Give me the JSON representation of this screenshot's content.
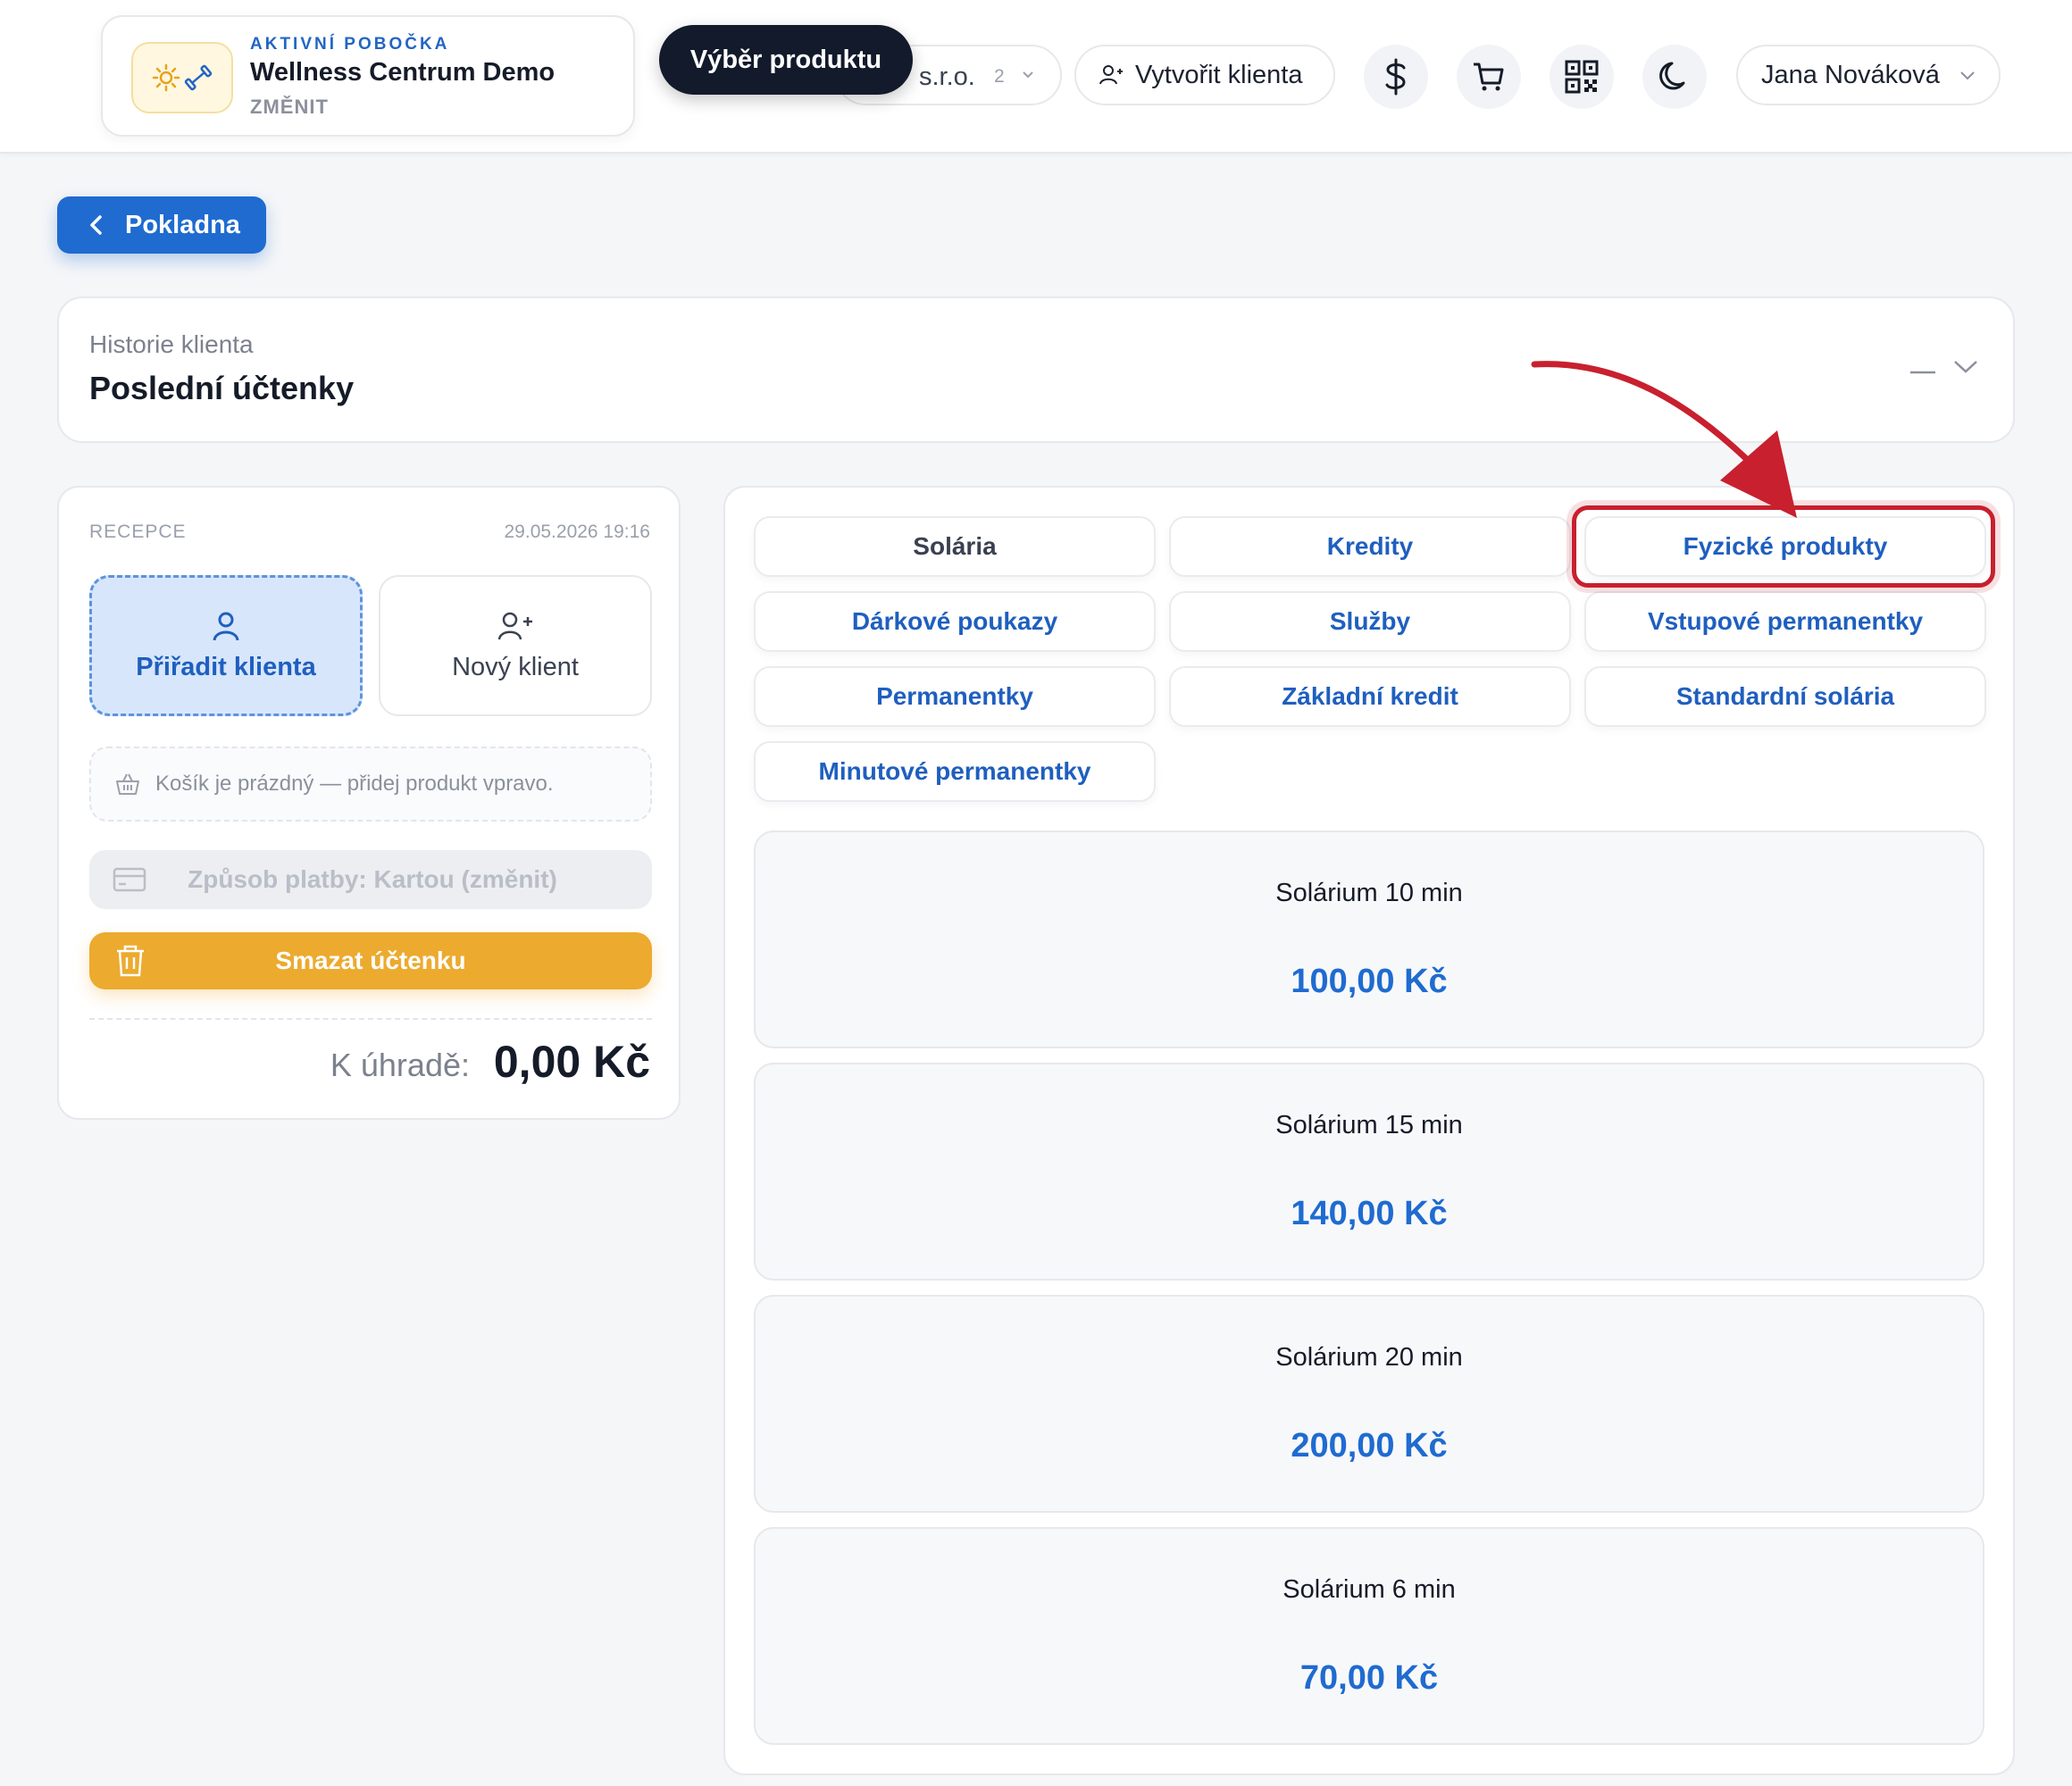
{
  "header": {
    "branch_kicker": "AKTIVNÍ POBOČKA",
    "branch_name": "Wellness Centrum Demo",
    "branch_change": "ZMĚNIT",
    "company_text": "s.r.o.",
    "company_count": "2",
    "tooltip": "Výběr produktu",
    "create_client": "Vytvořit klienta",
    "user_name": "Jana Nováková",
    "icons": [
      "dollar-icon",
      "cart-icon",
      "qr-code-icon",
      "moon-icon"
    ]
  },
  "back_button": "Pokladna",
  "history": {
    "kicker": "Historie klienta",
    "title": "Poslední účtenky"
  },
  "receipt": {
    "label": "RECEPCE",
    "date": "29.05.2026 19:16",
    "assign_client": "Přiřadit klienta",
    "new_client": "Nový klient",
    "cart_empty": "Košík je prázdný — přidej produkt vpravo.",
    "payment": "Způsob platby: Kartou (změnit)",
    "delete": "Smazat účtenku",
    "total_label": "K úhradě:",
    "total_value": "0,00 Kč"
  },
  "categories": [
    {
      "label": "Solária",
      "active": true
    },
    {
      "label": "Kredity"
    },
    {
      "label": "Fyzické produkty",
      "highlighted": true
    },
    {
      "label": "Dárkové poukazy"
    },
    {
      "label": "Služby"
    },
    {
      "label": "Vstupové permanentky"
    },
    {
      "label": "Permanentky"
    },
    {
      "label": "Základní kredit"
    },
    {
      "label": "Standardní solária"
    },
    {
      "label": "Minutové permanentky"
    }
  ],
  "products": [
    {
      "name": "Solárium 10 min",
      "price": "100,00 Kč"
    },
    {
      "name": "Solárium 15 min",
      "price": "140,00 Kč"
    },
    {
      "name": "Solárium 20 min",
      "price": "200,00 Kč"
    },
    {
      "name": "Solárium 6 min",
      "price": "70,00 Kč"
    }
  ],
  "colors": {
    "accent": "#1f6bd0",
    "warning": "#ecaa2f",
    "highlight": "#c8202e",
    "dark": "#121a2b"
  }
}
